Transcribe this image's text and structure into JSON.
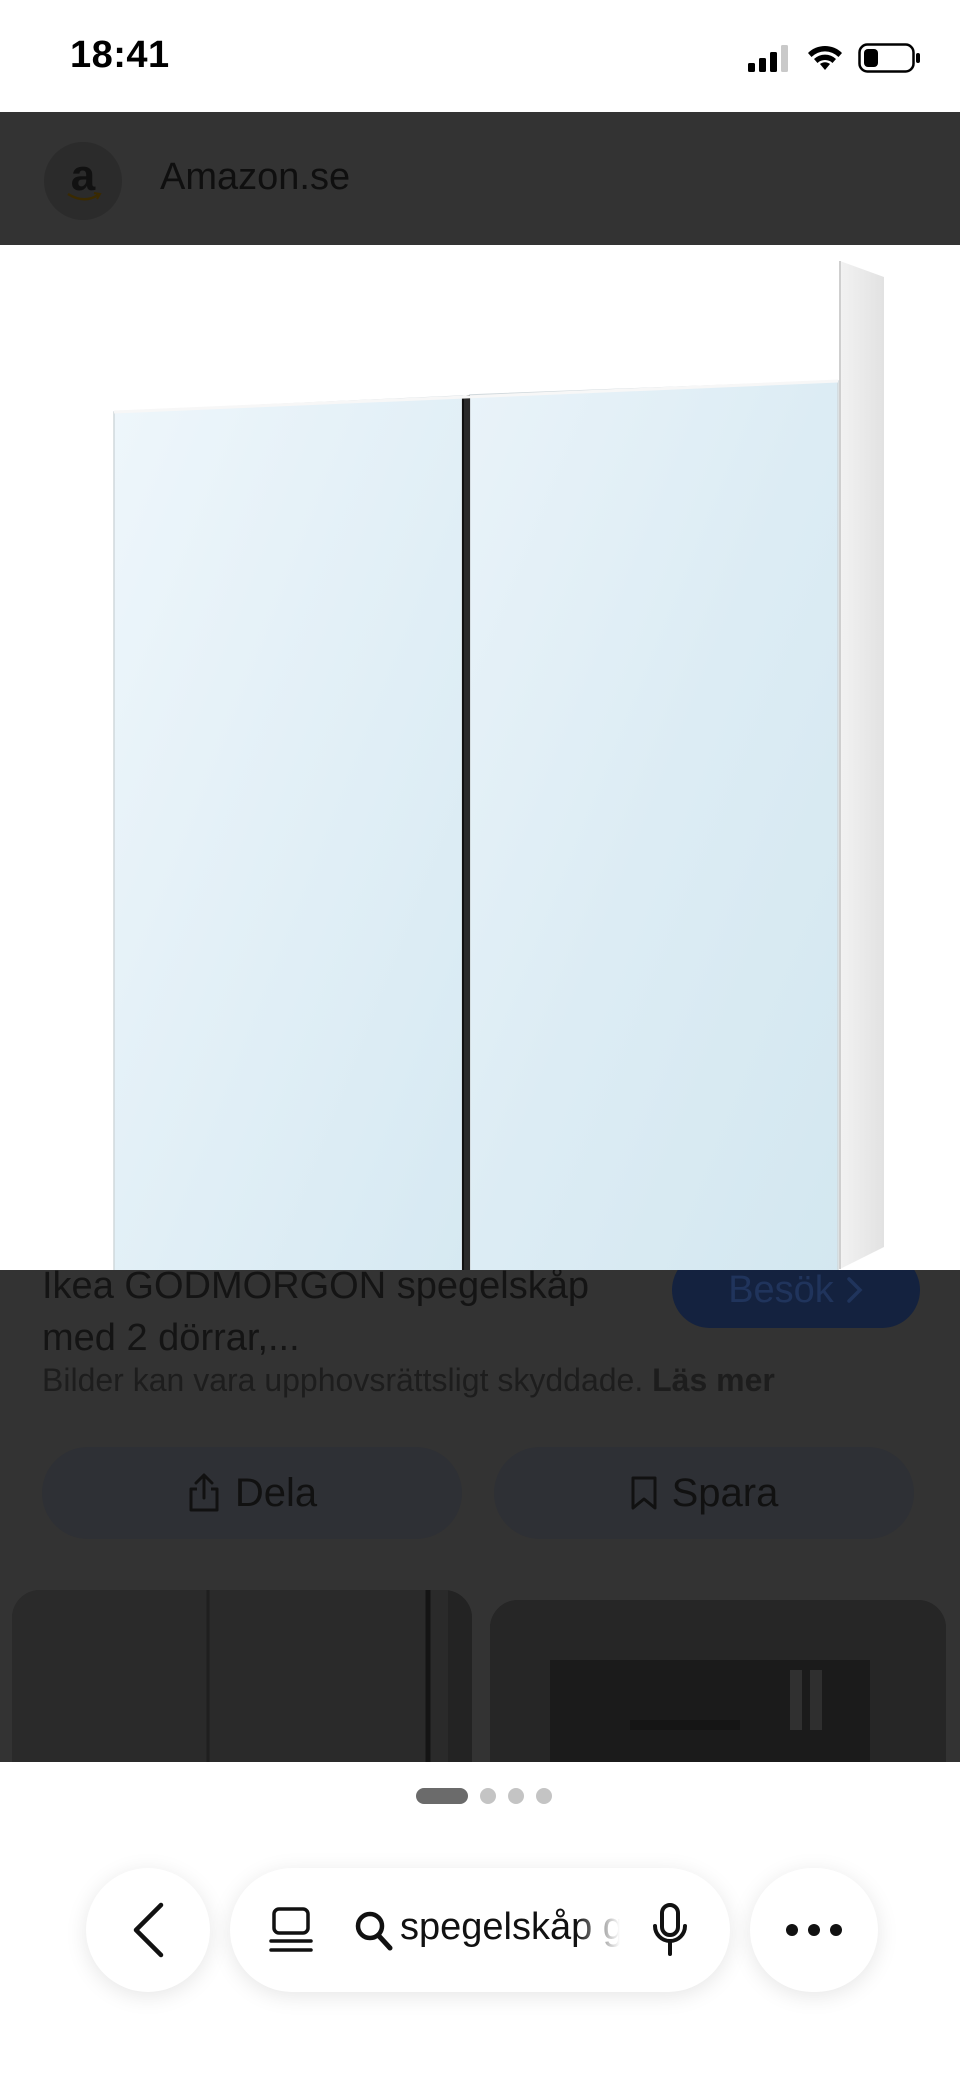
{
  "status_bar": {
    "time": "18:41"
  },
  "site": {
    "logo_letter": "a",
    "name": "Amazon.se"
  },
  "result": {
    "title": "Ikea GODMORGON spegelskåp med 2 dörrar,...",
    "visit_label": "Besök",
    "copyright_text": "Bilder kan vara upphovsrättsligt skyddade.",
    "read_more_label": "Läs mer"
  },
  "actions": {
    "share_label": "Dela",
    "save_label": "Spara"
  },
  "pager": {
    "total": 4,
    "active_index": 0
  },
  "toolbar": {
    "search_query": "spegelskåp godmorgon"
  },
  "colors": {
    "overlay": "#333333",
    "visit_button": "#14223f",
    "action_button": "#2e3035",
    "pager_active": "#6b6b6b",
    "pager_inactive": "#c4c4c4"
  },
  "icons": {
    "signal": "cellular-signal-icon",
    "wifi": "wifi-icon",
    "battery": "battery-icon",
    "visit": "chevron-right-icon",
    "share": "share-icon",
    "save": "bookmark-icon",
    "back": "chevron-left-icon",
    "tabs": "tabs-icon",
    "search": "search-icon",
    "mic": "microphone-icon",
    "more": "more-dots-icon"
  }
}
